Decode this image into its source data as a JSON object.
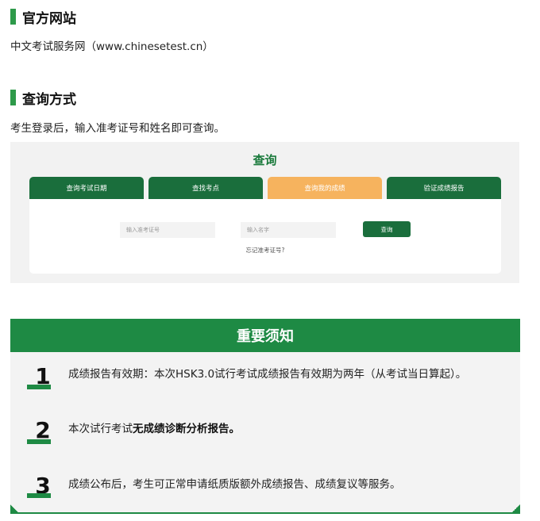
{
  "official_site": {
    "heading": "官方网站",
    "text": "中文考试服务网（www.chinesetest.cn）"
  },
  "query_method": {
    "heading": "查询方式",
    "text": "考生登录后，输入准考证号和姓名即可查询。"
  },
  "embedded_page": {
    "title": "查询",
    "tabs": [
      {
        "label": "查询考试日期",
        "active": false
      },
      {
        "label": "查找考点",
        "active": false
      },
      {
        "label": "查询我的成绩",
        "active": true
      },
      {
        "label": "验证成绩报告",
        "active": false
      }
    ],
    "admission_placeholder": "输入准考证号",
    "name_placeholder": "输入名字",
    "query_button": "查询",
    "forgot_link": "忘记准考证号?"
  },
  "notice": {
    "title": "重要须知",
    "items": [
      {
        "num": "1",
        "text": "成绩报告有效期：本次HSK3.0试行考试成绩报告有效期为两年（从考试当日算起）。"
      },
      {
        "num": "2",
        "text_prefix": "本次试行考试",
        "text_bold": "无成绩诊断分析报告。"
      },
      {
        "num": "3",
        "text": "成绩公布后，考生可正常申请纸质版额外成绩报告、成绩复议等服务。"
      }
    ]
  },
  "colors": {
    "green_accent": "#2e9a4a",
    "notice_green": "#1e8a44",
    "tab_green": "#1a6e3c",
    "tab_active_orange": "#f6b35e"
  }
}
